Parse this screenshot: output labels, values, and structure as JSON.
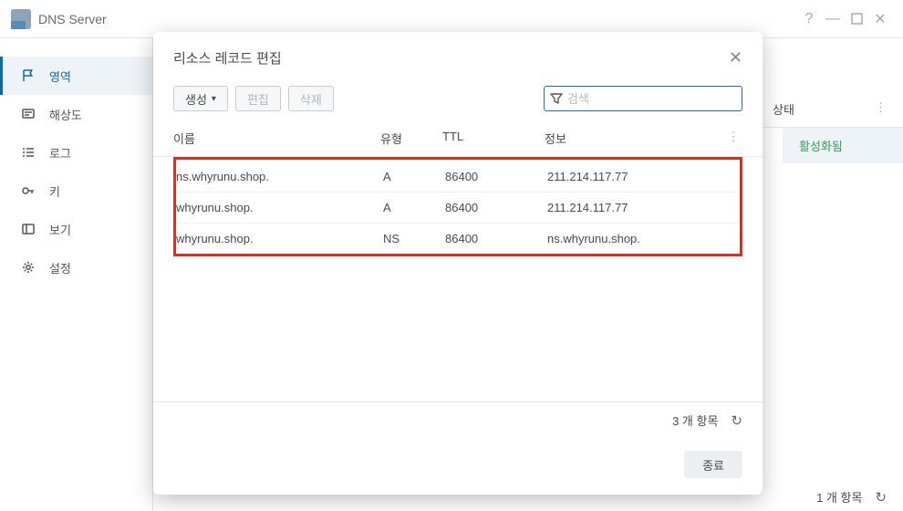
{
  "app": {
    "title": "DNS Server"
  },
  "sidebar": {
    "items": [
      {
        "label": "영역"
      },
      {
        "label": "해상도"
      },
      {
        "label": "로그"
      },
      {
        "label": "키"
      },
      {
        "label": "보기"
      },
      {
        "label": "설정"
      }
    ]
  },
  "bg": {
    "statusHeader": "상태",
    "statusValue": "활성화됨",
    "pageCount": "1 개 항목"
  },
  "modal": {
    "title": "리소스 레코드 편집",
    "toolbar": {
      "create": "생성",
      "edit": "편집",
      "delete": "삭제"
    },
    "search": {
      "placeholder": "검색"
    },
    "columns": {
      "name": "이름",
      "type": "유형",
      "ttl": "TTL",
      "info": "정보"
    },
    "rows": [
      {
        "name": "ns.whyrunu.shop.",
        "type": "A",
        "ttl": "86400",
        "info": "211.214.117.77"
      },
      {
        "name": "whyrunu.shop.",
        "type": "A",
        "ttl": "86400",
        "info": "211.214.117.77"
      },
      {
        "name": "whyrunu.shop.",
        "type": "NS",
        "ttl": "86400",
        "info": "ns.whyrunu.shop."
      }
    ],
    "count": "3 개 항목",
    "closeBtn": "종료"
  }
}
